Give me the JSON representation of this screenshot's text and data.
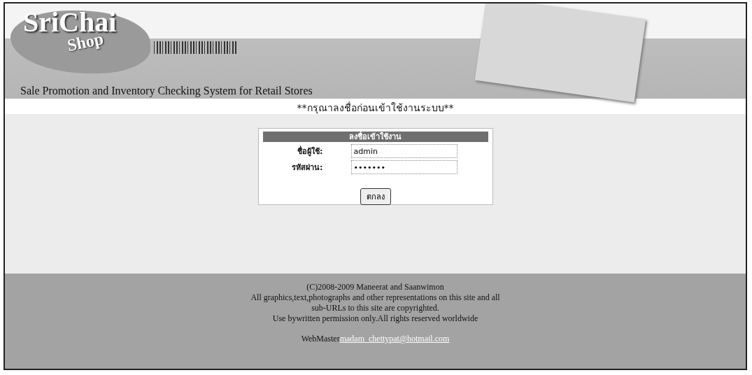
{
  "header": {
    "logo_main": "SriChai",
    "logo_sub": "Shop",
    "subtitle": "Sale Promotion and Inventory Checking System for Retail Stores"
  },
  "notice": "**กรุณาลงชื่อก่อนเข้าใช้งานระบบ**",
  "login": {
    "title": "ลงชื่อเข้าใช้งาน",
    "fields": [
      {
        "label": "ชื่อผู้ใช้:",
        "value": "admin"
      },
      {
        "label": "รหัสผ่าน:",
        "value": "•••••••"
      }
    ],
    "button": "ตกลง"
  },
  "footer": {
    "lines": [
      "(C)2008-2009 Maneerat and Saanwimon",
      "All graphics,text,photographs and other representations on this site and all",
      "sub-URLs to this site are copyrighted.",
      "Use bywritten permission only.All rights reserved worldwide"
    ],
    "webmaster_label": "WebMaster",
    "webmaster_email": "madam_chettypat@hotmail.com"
  }
}
